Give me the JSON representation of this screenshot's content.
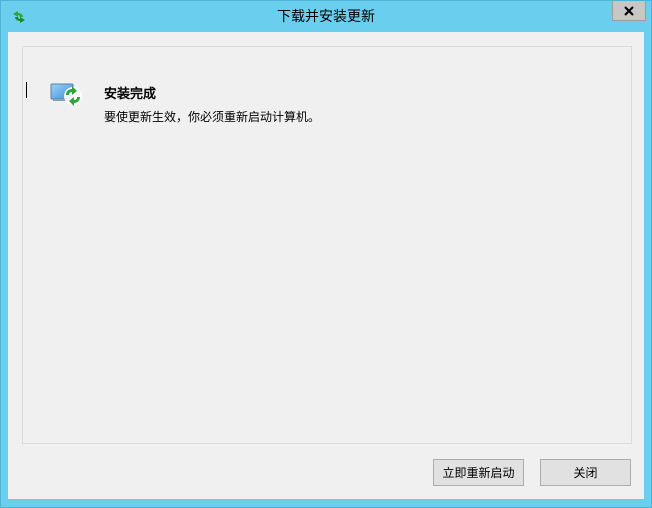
{
  "window": {
    "title": "下载并安装更新",
    "title_icon": "windows-update-icon",
    "close_icon": "close-icon"
  },
  "status": {
    "icon": "update-complete-icon",
    "title": "安装完成",
    "message": "要使更新生效，你必须重新启动计算机。"
  },
  "buttons": {
    "restart_now": "立即重新启动",
    "close": "关闭"
  },
  "colors": {
    "frame": "#6acfee",
    "client": "#f0f0f0",
    "button": "#e1e1e1",
    "close_button": "#c7c7c7",
    "update_green": "#2fa23a"
  }
}
